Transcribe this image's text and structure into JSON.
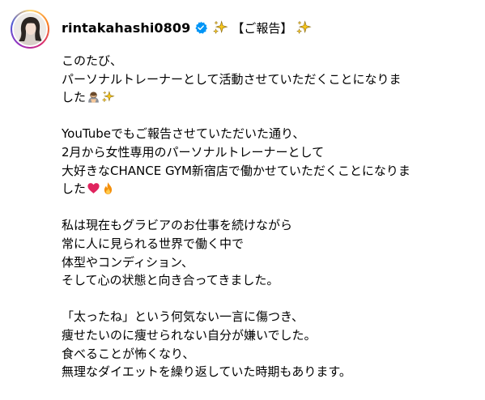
{
  "post": {
    "username": "rintakahashi0809",
    "header_text": "【ご報告】",
    "icons": {
      "avatar": "profile-photo",
      "verified": "verified-badge-icon",
      "sparkle": "sparkles-icon",
      "bow": "person-bowing-icon",
      "heart": "red-heart-icon",
      "fire": "fire-icon"
    },
    "colors": {
      "verified_badge": "#0095f6",
      "sparkle": "#f7c61b",
      "heart": "#e0245e",
      "fire": "#f4900c"
    },
    "caption": {
      "p1": {
        "l1": "このたび、",
        "l2": "パーソナルトレーナーとして活動させていただくことになりま",
        "l3": "した"
      },
      "p2": {
        "l1": "YouTubeでもご報告させていただいた通り、",
        "l2": "2月から女性専用のパーソナルトレーナーとして",
        "l3": "大好きなCHANCE GYM新宿店で働かせていただくことになりま",
        "l4": "した"
      },
      "p3": {
        "l1": "私は現在もグラビアのお仕事を続けながら",
        "l2": "常に人に見られる世界で働く中で",
        "l3": "体型やコンディション、",
        "l4": "そして心の状態と向き合ってきました。"
      },
      "p4": {
        "l1": "「太ったね」という何気ない一言に傷つき、",
        "l2": "痩せたいのに痩せられない自分が嫌いでした。",
        "l3": "食べることが怖くなり、",
        "l4": "無理なダイエットを繰り返していた時期もあります。"
      }
    }
  }
}
